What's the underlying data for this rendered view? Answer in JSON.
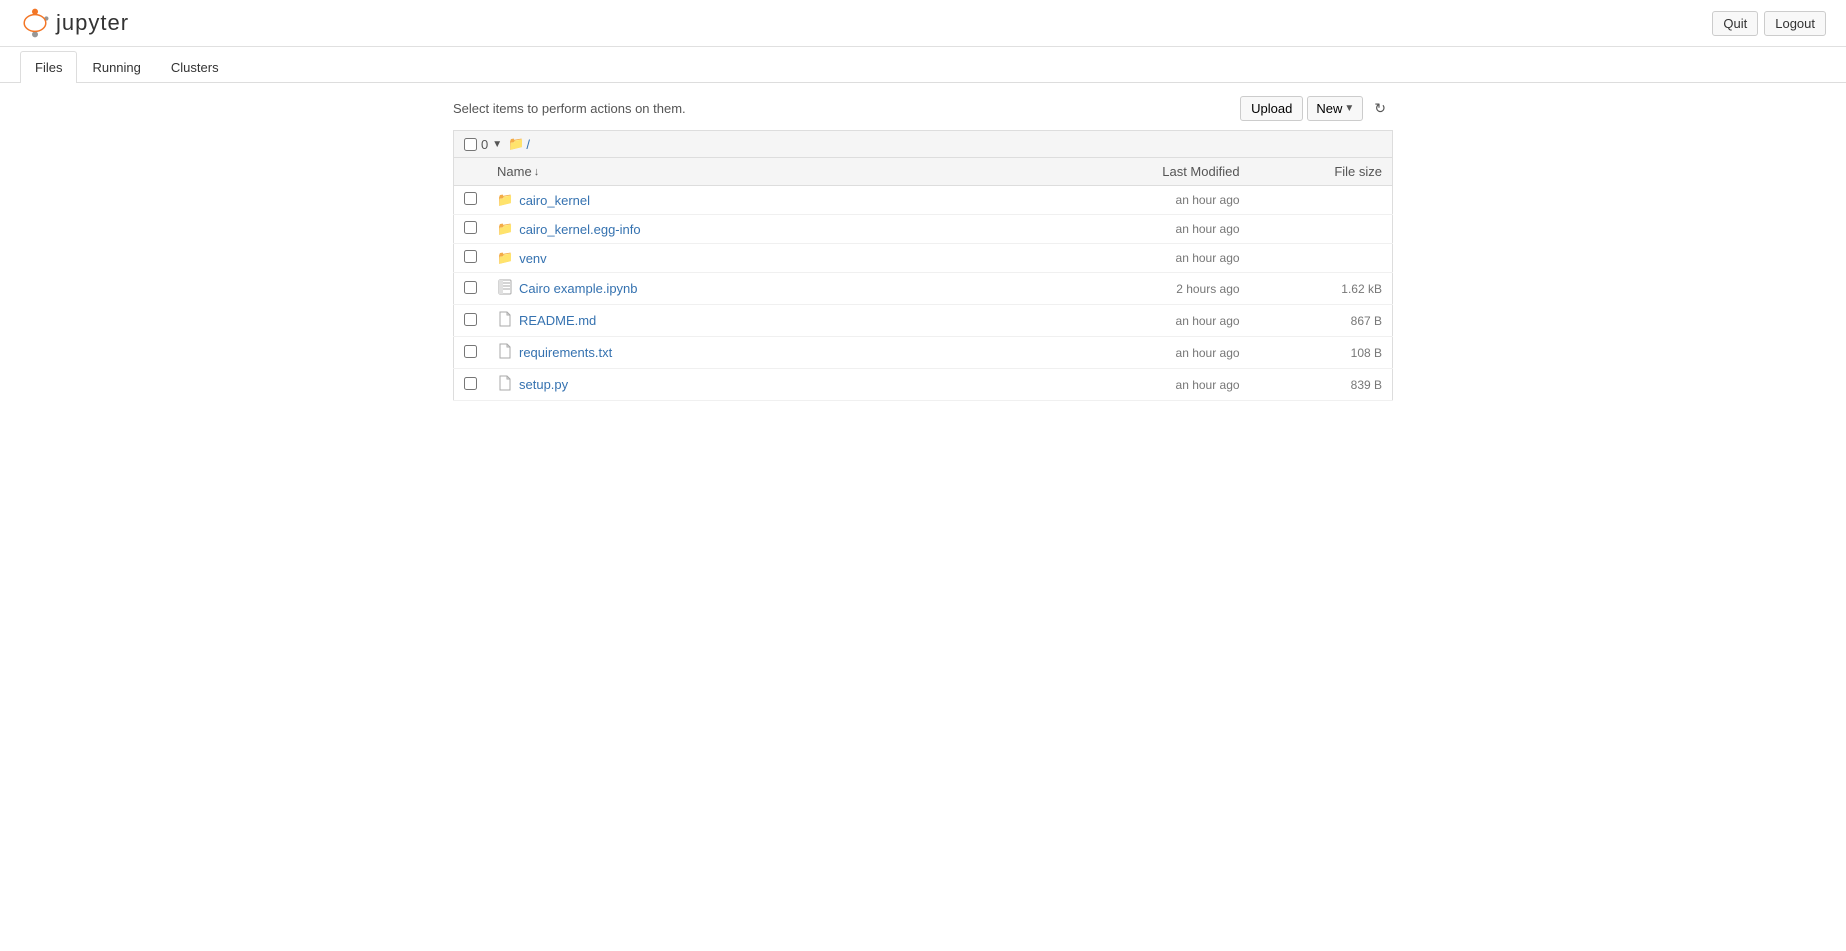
{
  "header": {
    "title": "jupyter",
    "quit_label": "Quit",
    "logout_label": "Logout"
  },
  "tabs": [
    {
      "id": "files",
      "label": "Files",
      "active": true
    },
    {
      "id": "running",
      "label": "Running",
      "active": false
    },
    {
      "id": "clusters",
      "label": "Clusters",
      "active": false
    }
  ],
  "toolbar": {
    "select_info": "Select items to perform actions on them.",
    "upload_label": "Upload",
    "new_label": "New",
    "refresh_icon": "↻"
  },
  "file_browser": {
    "check_count": "0",
    "current_path": "/",
    "columns": {
      "name": "Name",
      "last_modified": "Last Modified",
      "file_size": "File size"
    },
    "items": [
      {
        "type": "folder",
        "name": "cairo_kernel",
        "last_modified": "an hour ago",
        "file_size": ""
      },
      {
        "type": "folder",
        "name": "cairo_kernel.egg-info",
        "last_modified": "an hour ago",
        "file_size": ""
      },
      {
        "type": "folder",
        "name": "venv",
        "last_modified": "an hour ago",
        "file_size": ""
      },
      {
        "type": "notebook",
        "name": "Cairo example.ipynb",
        "last_modified": "2 hours ago",
        "file_size": "1.62 kB"
      },
      {
        "type": "file",
        "name": "README.md",
        "last_modified": "an hour ago",
        "file_size": "867 B"
      },
      {
        "type": "file",
        "name": "requirements.txt",
        "last_modified": "an hour ago",
        "file_size": "108 B"
      },
      {
        "type": "file",
        "name": "setup.py",
        "last_modified": "an hour ago",
        "file_size": "839 B"
      }
    ]
  }
}
